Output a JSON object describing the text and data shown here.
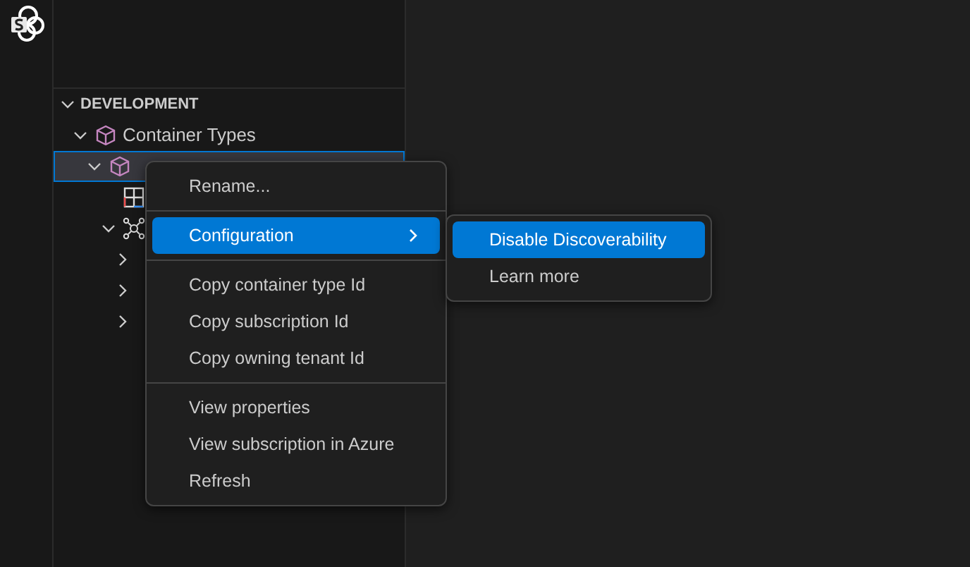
{
  "section": {
    "title": "DEVELOPMENT",
    "expanded": true
  },
  "tree": [
    {
      "label": "Container Types",
      "kind": "cube",
      "expanded": true,
      "selected": false,
      "children": [
        {
          "kind": "cube",
          "expanded": true,
          "selected": true,
          "children": [
            {
              "kind": "table",
              "selected": false
            },
            {
              "kind": "network",
              "expanded": true,
              "selected": false,
              "children": [
                {
                  "expanded": false,
                  "selected": false
                },
                {
                  "expanded": false,
                  "selected": false
                },
                {
                  "expanded": false,
                  "selected": false
                }
              ]
            }
          ]
        }
      ]
    }
  ],
  "context_menu": {
    "groups": [
      [
        {
          "label": "Rename...",
          "selected": false
        }
      ],
      [
        {
          "label": "Configuration",
          "selected": true,
          "submenu": true
        }
      ],
      [
        {
          "label": "Copy container type Id",
          "selected": false
        },
        {
          "label": "Copy subscription Id",
          "selected": false
        },
        {
          "label": "Copy owning tenant Id",
          "selected": false
        }
      ],
      [
        {
          "label": "View properties",
          "selected": false
        },
        {
          "label": "View subscription in Azure",
          "selected": false
        },
        {
          "label": "Refresh",
          "selected": false
        }
      ]
    ]
  },
  "submenu": {
    "items": [
      {
        "label": "Disable Discoverability",
        "selected": true
      },
      {
        "label": "Learn more",
        "selected": false
      }
    ]
  }
}
